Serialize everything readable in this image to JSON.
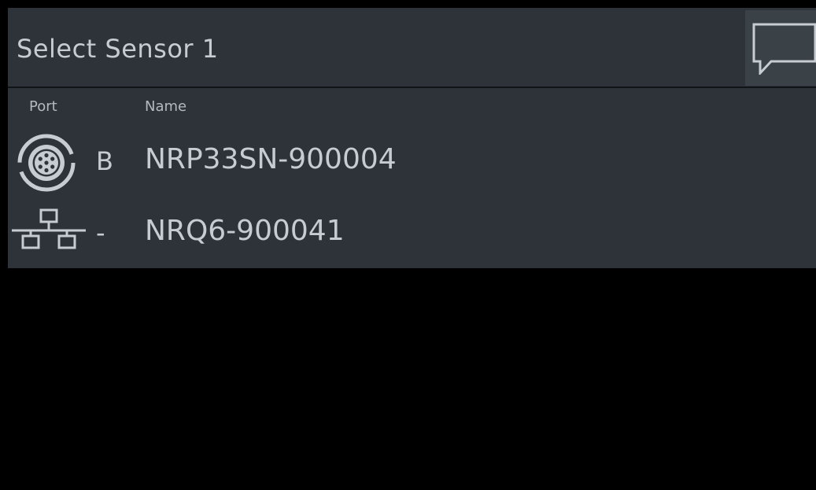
{
  "header": {
    "title": "Select Sensor 1",
    "message_icon": "message-icon"
  },
  "list": {
    "columns": {
      "port": "Port",
      "name": "Name"
    },
    "sensors": [
      {
        "icon": "sensor-connector-icon",
        "port": "B",
        "name": "NRP33SN-900004"
      },
      {
        "icon": "network-icon",
        "port": "-",
        "name": "NRQ6-900041"
      }
    ]
  },
  "colors": {
    "panel": "#2d3338",
    "text": "#c6ccd1",
    "background": "#000000"
  }
}
